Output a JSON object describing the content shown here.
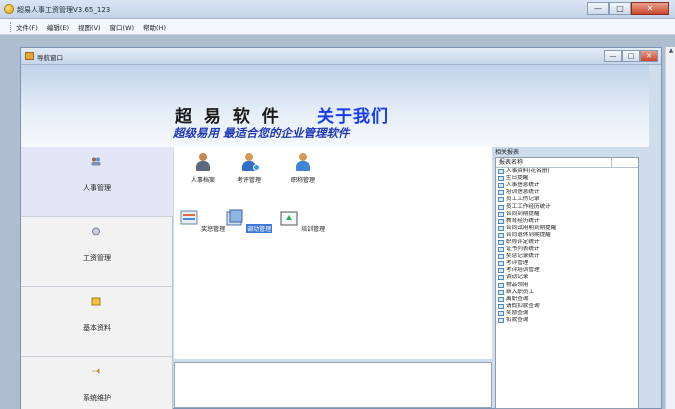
{
  "window": {
    "title": "超易人事工资管理V3.65_123",
    "buttons": [
      "—",
      "□",
      "✕"
    ]
  },
  "menu": [
    "文件(F)",
    "编辑(E)",
    "视图(V)",
    "窗口(W)",
    "帮助(H)"
  ],
  "child_window": {
    "title": "导航窗口",
    "buttons": [
      "—",
      "□",
      "✕"
    ]
  },
  "banner": {
    "brand": "超 易 软 件",
    "about": "关于我们",
    "slogan": "超级易用 最适合您的企业管理软件"
  },
  "leftnav": [
    {
      "label": "人事管理",
      "icon": "people-icon"
    },
    {
      "label": "工资管理",
      "icon": "money-icon"
    },
    {
      "label": "基本资料",
      "icon": "folder-icon"
    },
    {
      "label": "系统维护",
      "icon": "tools-icon"
    }
  ],
  "modules": [
    {
      "label": "人事档案",
      "icon": "person-icon"
    },
    {
      "label": "考评管理",
      "icon": "evaluation-icon"
    },
    {
      "label": "职称管理",
      "icon": "title-icon"
    },
    {
      "label": "奖惩管理",
      "icon": "reward-icon"
    },
    {
      "label": "调动管理",
      "icon": "transfer-icon"
    },
    {
      "label": "培训管理",
      "icon": "training-icon"
    }
  ],
  "reports": {
    "title": "相关报表",
    "column": "报表名称",
    "items": [
      "人事资料(花名册)",
      "生日提醒",
      "人事信息统计",
      "培训信息统计",
      "员工工伤记录",
      "员工工作经历统计",
      "合同到期提醒",
      "教育经历统计",
      "合同试用期到期提醒",
      "合同退休到期提醒",
      "职称评定统计",
      "证书列表统计",
      "奖惩记录统计",
      "考评管理",
      "考评培训管理",
      "调动记录",
      "物品领用",
      "新入职员工",
      "离职查询",
      "请假扣款查询",
      "奖励查询",
      "扣款查询"
    ]
  },
  "colors": {
    "accent": "#1a3cf0",
    "selected": "#3c78d8",
    "nav_active": "#e2e6f7"
  }
}
